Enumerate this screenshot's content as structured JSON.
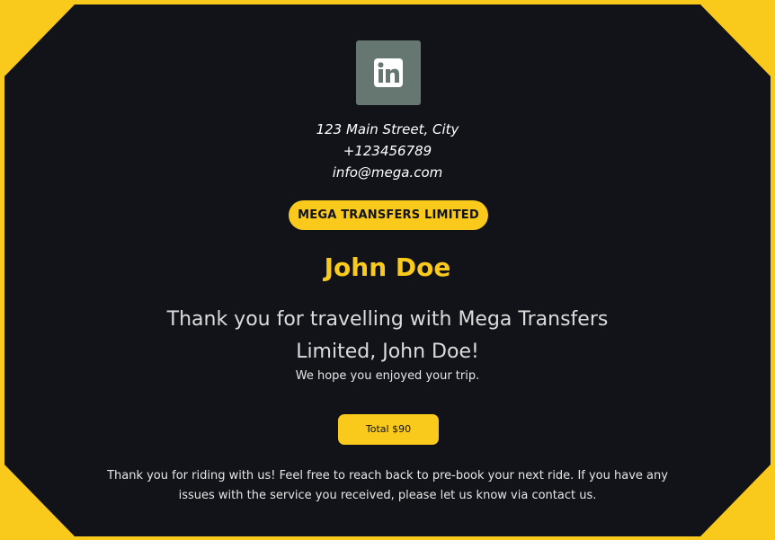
{
  "brand": {
    "logo_icon": "linkedin-icon",
    "logo_bg_color": "#667771",
    "accent_color": "#f9c91b",
    "background_color": "#111318"
  },
  "contact": {
    "address": "123 Main Street, City",
    "phone": "+123456789",
    "email": "info@mega.com"
  },
  "company": {
    "name": "MEGA TRANSFERS LIMITED"
  },
  "customer": {
    "name": "John Doe"
  },
  "message": {
    "thanks": "Thank you for travelling with Mega Transfers Limited, John Doe!",
    "hope": "We hope you enjoyed your trip."
  },
  "total": {
    "label": "Total $90"
  },
  "footer": {
    "text": "Thank you for riding with us! Feel free to reach back to pre-book your next ride. If you have any issues with the service you received, please let us know via contact us."
  }
}
